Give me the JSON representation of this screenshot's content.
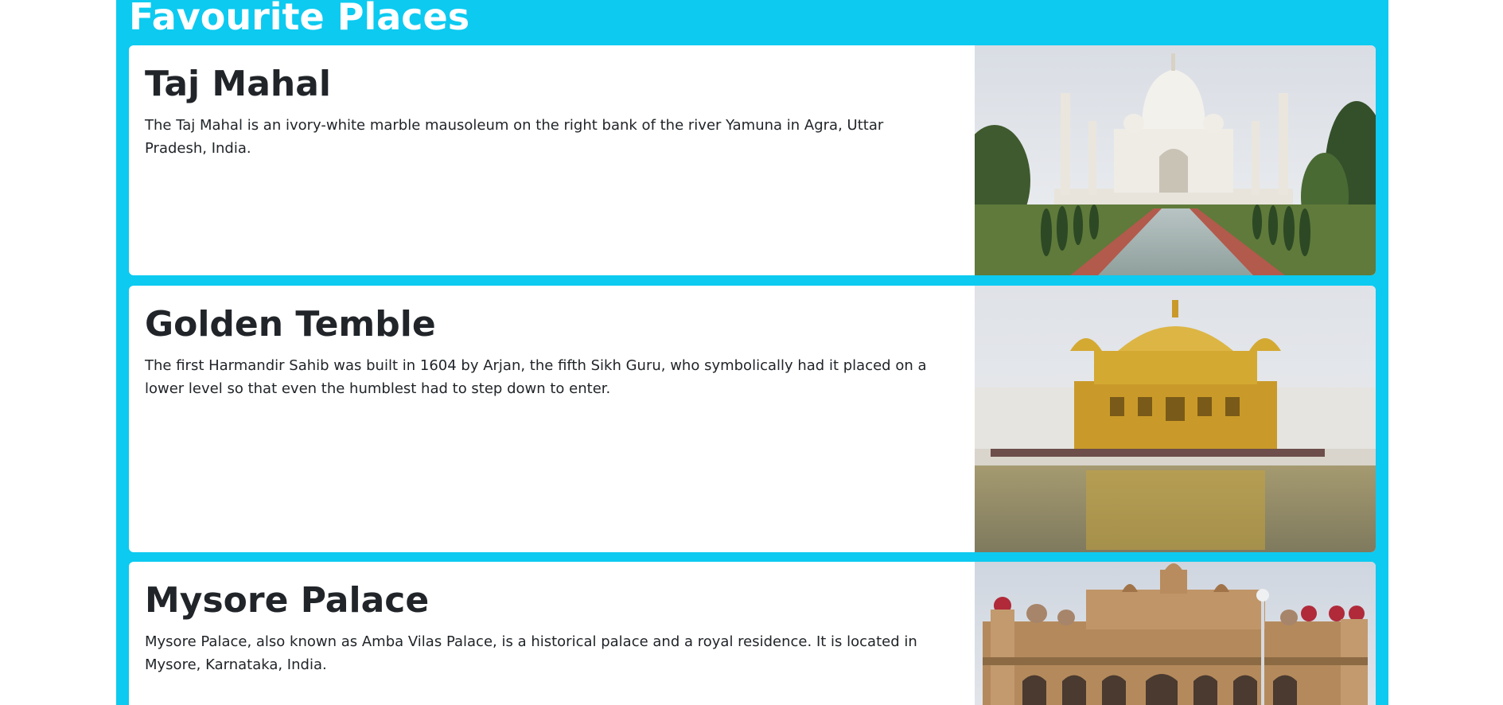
{
  "page": {
    "title": "Favourite Places",
    "accent_color": "#0dcaf0"
  },
  "places": [
    {
      "name": "Taj Mahal",
      "description": "The Taj Mahal is an ivory-white marble mausoleum on the right bank of the river Yamuna in Agra, Uttar Pradesh, India.",
      "photo": "taj-mahal-photo"
    },
    {
      "name": "Golden Temble",
      "description": "The first Harmandir Sahib was built in 1604 by Arjan, the fifth Sikh Guru, who symbolically had it placed on a lower level so that even the humblest had to step down to enter.",
      "photo": "golden-temple-photo"
    },
    {
      "name": "Mysore Palace",
      "description": "Mysore Palace, also known as Amba Vilas Palace, is a historical palace and a royal residence. It is located in Mysore, Karnataka, India.",
      "photo": "mysore-palace-photo"
    }
  ]
}
